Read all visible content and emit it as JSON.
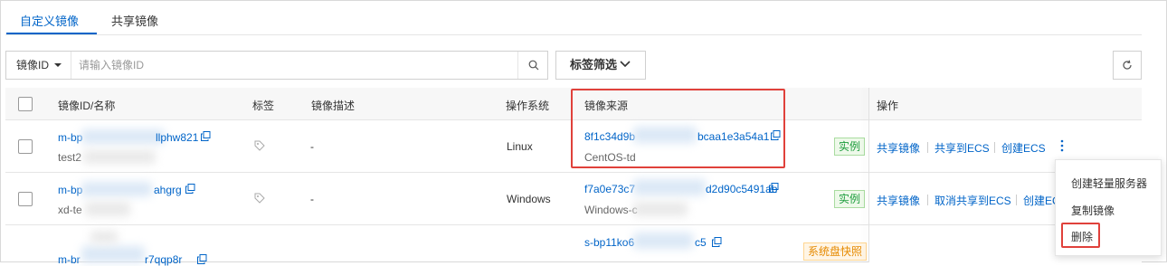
{
  "tabs": [
    {
      "label": "自定义镜像",
      "active": true
    },
    {
      "label": "共享镜像",
      "active": false
    }
  ],
  "search": {
    "field_select": "镜像ID",
    "placeholder": "请输入镜像ID",
    "value": ""
  },
  "toolbar": {
    "tag_filter_label": "标签筛选"
  },
  "table": {
    "headers": {
      "id_name": "镜像ID/名称",
      "tags": "标签",
      "description": "镜像描述",
      "os": "操作系统",
      "source": "镜像来源",
      "actions": "操作"
    },
    "rows": [
      {
        "id_prefix": "m-bp",
        "id_suffix": "llphw821",
        "name_prefix": "test2",
        "description": "-",
        "os": "Linux",
        "source_id_prefix": "8f1c34d9b",
        "source_id_suffix": "bcaa1e3a54a1",
        "source_name": "CentOS-td",
        "badge": "实例",
        "actions": [
          "共享镜像",
          "共享到ECS",
          "创建ECS"
        ]
      },
      {
        "id_prefix": "m-bp",
        "id_suffix": "ahgrg",
        "name_prefix": "xd-te",
        "description": "-",
        "os": "Windows",
        "source_id_prefix": "f7a0e73c7",
        "source_id_suffix": "d2d90c5491ab",
        "source_name": "Windows-c",
        "badge": "实例",
        "actions": [
          "共享镜像",
          "取消共享到ECS",
          "创建EC"
        ]
      },
      {
        "id_prefix": "m-br",
        "id_suffix": "r7qqp8r",
        "source_id_prefix": "s-bp11ko6",
        "source_id_suffix": "c5",
        "badge": "系统盘快照"
      }
    ]
  },
  "more_menu": {
    "items": [
      "创建轻量服务器",
      "复制镜像",
      "删除"
    ]
  },
  "colors": {
    "accent": "#0064c8",
    "highlight_red": "#e0413b",
    "badge_green": "#1e9e3e",
    "badge_orange": "#e68a00"
  },
  "icons": {
    "search": "search-icon",
    "refresh": "refresh-icon",
    "copy": "copy-icon",
    "tag": "tag-icon",
    "more": "more-vertical-icon",
    "chevron": "chevron-down-icon"
  }
}
